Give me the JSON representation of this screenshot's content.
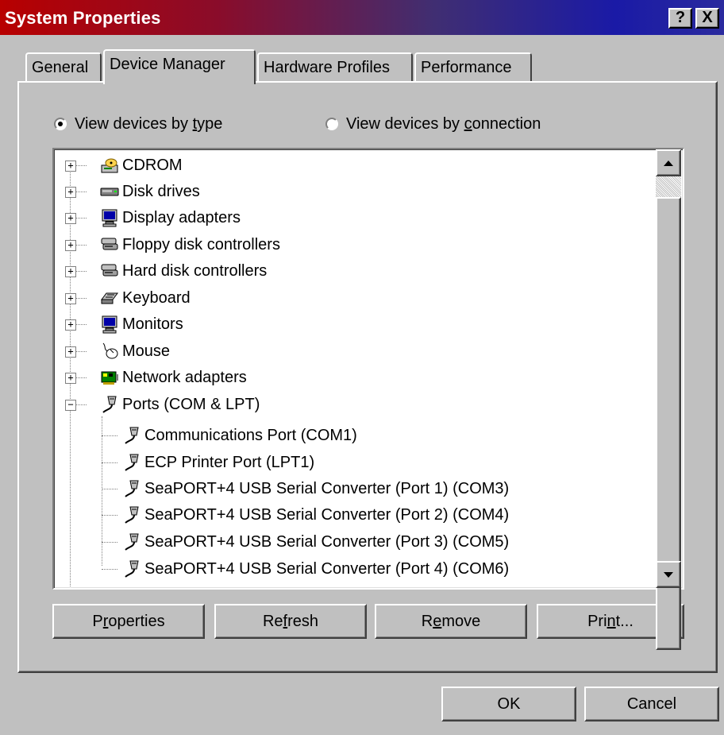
{
  "window": {
    "title": "System Properties",
    "help_label": "?",
    "close_label": "X"
  },
  "tabs": [
    {
      "label": "General"
    },
    {
      "label": "Device Manager"
    },
    {
      "label": "Hardware Profiles"
    },
    {
      "label": "Performance"
    }
  ],
  "view_options": {
    "by_type": {
      "label": "View devices by type",
      "checked": true
    },
    "by_connection": {
      "label": "View devices by connection",
      "checked": false
    }
  },
  "device_tree": [
    {
      "label": "CDROM",
      "icon": "cdrom-icon",
      "expanded": false
    },
    {
      "label": "Disk drives",
      "icon": "disk-drive-icon",
      "expanded": false
    },
    {
      "label": "Display adapters",
      "icon": "display-adapter-icon",
      "expanded": false
    },
    {
      "label": "Floppy disk controllers",
      "icon": "controller-icon",
      "expanded": false
    },
    {
      "label": "Hard disk controllers",
      "icon": "controller-icon",
      "expanded": false
    },
    {
      "label": "Keyboard",
      "icon": "keyboard-icon",
      "expanded": false
    },
    {
      "label": "Monitors",
      "icon": "monitor-icon",
      "expanded": false
    },
    {
      "label": "Mouse",
      "icon": "mouse-icon",
      "expanded": false
    },
    {
      "label": "Network adapters",
      "icon": "network-adapter-icon",
      "expanded": false
    },
    {
      "label": "Ports (COM & LPT)",
      "icon": "port-icon",
      "expanded": true,
      "children": [
        {
          "label": "Communications Port (COM1)",
          "icon": "port-icon"
        },
        {
          "label": "ECP Printer Port (LPT1)",
          "icon": "port-icon"
        },
        {
          "label": "SeaPORT+4 USB Serial Converter (Port 1) (COM3)",
          "icon": "port-icon"
        },
        {
          "label": "SeaPORT+4 USB Serial Converter (Port 2) (COM4)",
          "icon": "port-icon"
        },
        {
          "label": "SeaPORT+4 USB Serial Converter (Port 3) (COM5)",
          "icon": "port-icon"
        },
        {
          "label": "SeaPORT+4 USB Serial Converter (Port 4) (COM6)",
          "icon": "port-icon"
        }
      ]
    }
  ],
  "action_buttons": {
    "properties": "Properties",
    "refresh": "Refresh",
    "remove": "Remove",
    "print": "Print..."
  },
  "dialog_buttons": {
    "ok": "OK",
    "cancel": "Cancel"
  },
  "colors": {
    "face": "#c0c0c0",
    "title_start": "#b80000",
    "title_end": "#1a1aa6"
  }
}
